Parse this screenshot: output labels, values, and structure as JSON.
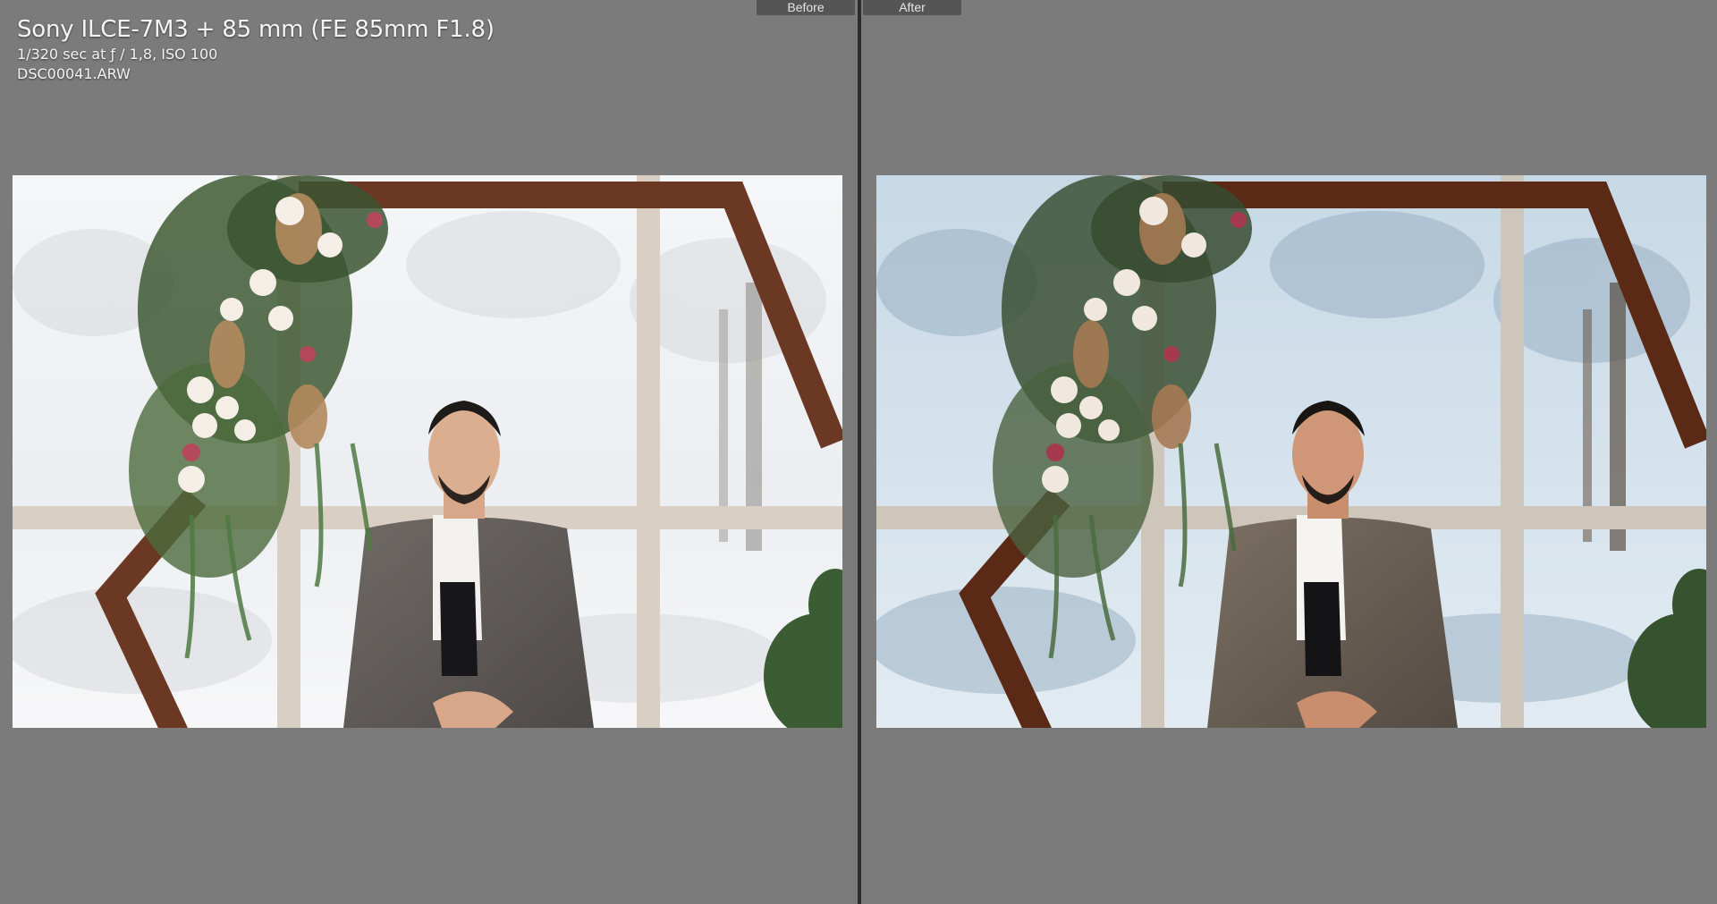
{
  "compare_view": {
    "before_label": "Before",
    "after_label": "After"
  },
  "info_overlay": {
    "camera_lens": "Sony ILCE-7M3 + 85 mm (FE 85mm F1.8)",
    "exposure": "1/320 sec at ƒ / 1,8, ISO 100",
    "filename": "DSC00041.ARW"
  },
  "colors": {
    "background": "#7b7b7b",
    "divider": "#2c2c2c",
    "tab_background": "#555555",
    "tab_text": "#e6e6e6",
    "overlay_text": "#f4f4f4"
  }
}
